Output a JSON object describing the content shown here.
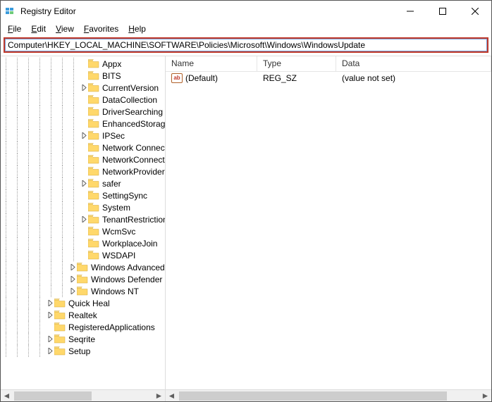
{
  "window": {
    "title": "Registry Editor"
  },
  "menu": {
    "file": "File",
    "edit": "Edit",
    "view": "View",
    "favorites": "Favorites",
    "help": "Help"
  },
  "address": {
    "value": "Computer\\HKEY_LOCAL_MACHINE\\SOFTWARE\\Policies\\Microsoft\\Windows\\WindowsUpdate"
  },
  "list": {
    "headers": {
      "name": "Name",
      "type": "Type",
      "data": "Data"
    },
    "rows": [
      {
        "name": "(Default)",
        "type": "REG_SZ",
        "data": "(value not set)"
      }
    ]
  },
  "tree": {
    "nodes": [
      {
        "indent": 7,
        "expander": "",
        "label": "Appx"
      },
      {
        "indent": 7,
        "expander": "",
        "label": "BITS"
      },
      {
        "indent": 7,
        "expander": ">",
        "label": "CurrentVersion"
      },
      {
        "indent": 7,
        "expander": "",
        "label": "DataCollection"
      },
      {
        "indent": 7,
        "expander": "",
        "label": "DriverSearching"
      },
      {
        "indent": 7,
        "expander": "",
        "label": "EnhancedStorageDevices"
      },
      {
        "indent": 7,
        "expander": ">",
        "label": "IPSec"
      },
      {
        "indent": 7,
        "expander": "",
        "label": "Network Connections"
      },
      {
        "indent": 7,
        "expander": "",
        "label": "NetworkConnectivityStatusIndicator"
      },
      {
        "indent": 7,
        "expander": "",
        "label": "NetworkProvider"
      },
      {
        "indent": 7,
        "expander": ">",
        "label": "safer"
      },
      {
        "indent": 7,
        "expander": "",
        "label": "SettingSync"
      },
      {
        "indent": 7,
        "expander": "",
        "label": "System"
      },
      {
        "indent": 7,
        "expander": ">",
        "label": "TenantRestrictions"
      },
      {
        "indent": 7,
        "expander": "",
        "label": "WcmSvc"
      },
      {
        "indent": 7,
        "expander": "",
        "label": "WorkplaceJoin"
      },
      {
        "indent": 7,
        "expander": "",
        "label": "WSDAPI"
      },
      {
        "indent": 6,
        "expander": ">",
        "label": "Windows Advanced Threat Protection"
      },
      {
        "indent": 6,
        "expander": ">",
        "label": "Windows Defender"
      },
      {
        "indent": 6,
        "expander": ">",
        "label": "Windows NT"
      },
      {
        "indent": 4,
        "expander": ">",
        "label": "Quick Heal"
      },
      {
        "indent": 4,
        "expander": ">",
        "label": "Realtek"
      },
      {
        "indent": 4,
        "expander": "",
        "label": "RegisteredApplications"
      },
      {
        "indent": 4,
        "expander": ">",
        "label": "Seqrite"
      },
      {
        "indent": 4,
        "expander": ">",
        "label": "Setup"
      }
    ]
  }
}
